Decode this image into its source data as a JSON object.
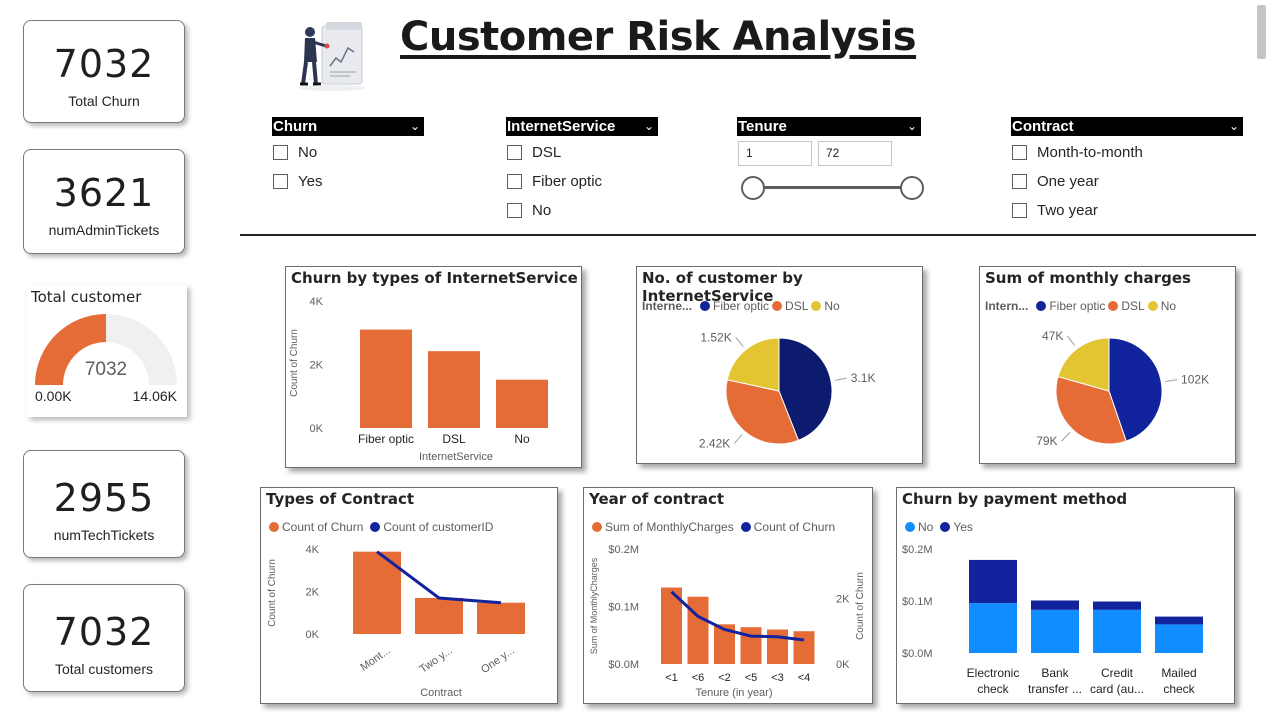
{
  "title": "Customer Risk Analysis",
  "colors": {
    "orange": "#E66C37",
    "navy": "#12239E",
    "darknavy": "#0D1B6E",
    "yellow": "#E3C433",
    "blue": "#118DFF",
    "gaugeBg": "#F0F0F0"
  },
  "kpis": {
    "total_churn": {
      "value": "7032",
      "label": "Total Churn"
    },
    "admin_tickets": {
      "value": "3621",
      "label": "numAdminTickets"
    },
    "tech_tickets": {
      "value": "2955",
      "label": "numTechTickets"
    },
    "total_customers": {
      "value": "7032",
      "label": "Total customers"
    }
  },
  "gauge": {
    "title": "Total customer",
    "value": "7032",
    "min": "0.00K",
    "max": "14.06K",
    "fraction": 0.5
  },
  "slicers": {
    "churn": {
      "header": "Churn",
      "items": [
        "No",
        "Yes"
      ]
    },
    "internet": {
      "header": "InternetService",
      "items": [
        "DSL",
        "Fiber optic",
        "No"
      ]
    },
    "tenure": {
      "header": "Tenure",
      "min": "1",
      "max": "72"
    },
    "contract": {
      "header": "Contract",
      "items": [
        "Month-to-month",
        "One year",
        "Two year"
      ]
    }
  },
  "chart_data": [
    {
      "type": "bar",
      "title": "Churn by types of InternetService",
      "xlabel": "InternetService",
      "ylabel": "Count of Churn",
      "yticks": [
        "0K",
        "2K",
        "4K"
      ],
      "ylim": [
        0,
        4000
      ],
      "categories": [
        "Fiber optic",
        "DSL",
        "No"
      ],
      "values": [
        3100,
        2420,
        1520
      ]
    },
    {
      "type": "pie",
      "title": "No. of customer by InternetService",
      "legend_title": "Interne...",
      "labels": [
        "Fiber optic",
        "DSL",
        "No"
      ],
      "values": [
        3100,
        2420,
        1520
      ],
      "value_labels": [
        "3.1K",
        "2.42K",
        "1.52K"
      ]
    },
    {
      "type": "pie",
      "title": "Sum of monthly charges",
      "legend_title": "Intern...",
      "labels": [
        "Fiber optic",
        "DSL",
        "No"
      ],
      "values": [
        102000,
        79000,
        47000
      ],
      "value_labels": [
        "102K",
        "79K",
        "47K"
      ]
    },
    {
      "type": "bar",
      "title": "Types of Contract",
      "xlabel": "Contract",
      "ylabel": "Count of Churn",
      "yticks": [
        "0K",
        "2K",
        "4K"
      ],
      "ylim": [
        0,
        4000
      ],
      "categories": [
        "Mont...",
        "Two y...",
        "One y..."
      ],
      "series": [
        {
          "name": "Count of Churn",
          "values": [
            3875,
            1695,
            1473
          ]
        },
        {
          "name": "Count of customerID",
          "values": [
            3875,
            1695,
            1473
          ]
        }
      ]
    },
    {
      "type": "bar",
      "title": "Year of contract",
      "xlabel": "Tenure (in year)",
      "ylabel": "Sum of MonthlyCharges",
      "ylabel2": "Count of Churn",
      "yticks": [
        "$0.0M",
        "$0.1M",
        "$0.2M"
      ],
      "yticks2": [
        "0K",
        "2K"
      ],
      "ylim": [
        0,
        0.2
      ],
      "ylim2": [
        0,
        3500
      ],
      "categories": [
        "<1",
        "<6",
        "<2",
        "<5",
        "<3",
        "<4"
      ],
      "series": [
        {
          "name": "Sum of MonthlyCharges",
          "values": [
            0.133,
            0.117,
            0.069,
            0.064,
            0.06,
            0.057
          ]
        },
        {
          "name": "Count of Churn",
          "values": [
            2200,
            1450,
            1050,
            850,
            830,
            730
          ]
        }
      ]
    },
    {
      "type": "bar",
      "title": "Churn by payment method",
      "yticks": [
        "$0.0M",
        "$0.1M",
        "$0.2M"
      ],
      "ylim": [
        0,
        0.2
      ],
      "categories": [
        "Electronic check",
        "Bank transfer ...",
        "Credit card (au...",
        "Mailed check"
      ],
      "series": [
        {
          "name": "No",
          "values": [
            0.096,
            0.083,
            0.083,
            0.055
          ]
        },
        {
          "name": "Yes",
          "values": [
            0.083,
            0.018,
            0.016,
            0.015
          ]
        }
      ]
    }
  ]
}
